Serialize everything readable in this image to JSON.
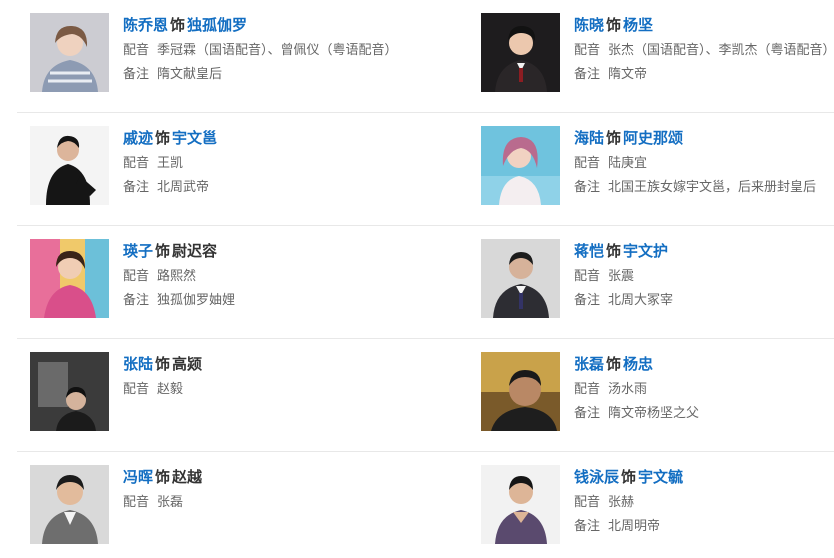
{
  "labels": {
    "shi": "饰",
    "dubbing": "配音",
    "note": "备注"
  },
  "rows": [
    {
      "left": {
        "actor": "陈乔恩",
        "role": "独孤伽罗",
        "dubbing": "季冠霖（国语配音）、曾佩仪（粤语配音）",
        "note": "隋文献皇后"
      },
      "right": {
        "actor": "陈晓",
        "role": "杨坚",
        "dubbing": "张杰（国语配音）、李凯杰（粤语配音）",
        "note": "隋文帝"
      }
    },
    {
      "left": {
        "actor": "戚迹",
        "role": "宇文邕",
        "dubbing": "王凯",
        "note": "北周武帝"
      },
      "right": {
        "actor": "海陆",
        "role": "阿史那颂",
        "dubbing": "陆庚宜",
        "note": "北国王族女嫁宇文邕，后来册封皇后"
      }
    },
    {
      "left": {
        "actor": "瑛子",
        "role": "尉迟容",
        "dubbing": "路熙然",
        "note": "独孤伽罗妯娌"
      },
      "right": {
        "actor": "蒋恺",
        "role": "宇文护",
        "dubbing": "张震",
        "note": "北周大冢宰"
      }
    },
    {
      "left": {
        "actor": "张陆",
        "role": "高颎",
        "dubbing": "赵毅",
        "note": ""
      },
      "right": {
        "actor": "张磊",
        "role": "杨忠",
        "dubbing": "汤水雨",
        "note": "隋文帝杨坚之父"
      }
    },
    {
      "left": {
        "actor": "冯晖",
        "role": "赵越",
        "dubbing": "张磊",
        "note": ""
      },
      "right": {
        "actor": "钱泳辰",
        "role": "宇文毓",
        "dubbing": "张赫",
        "note": "北周明帝"
      }
    }
  ]
}
